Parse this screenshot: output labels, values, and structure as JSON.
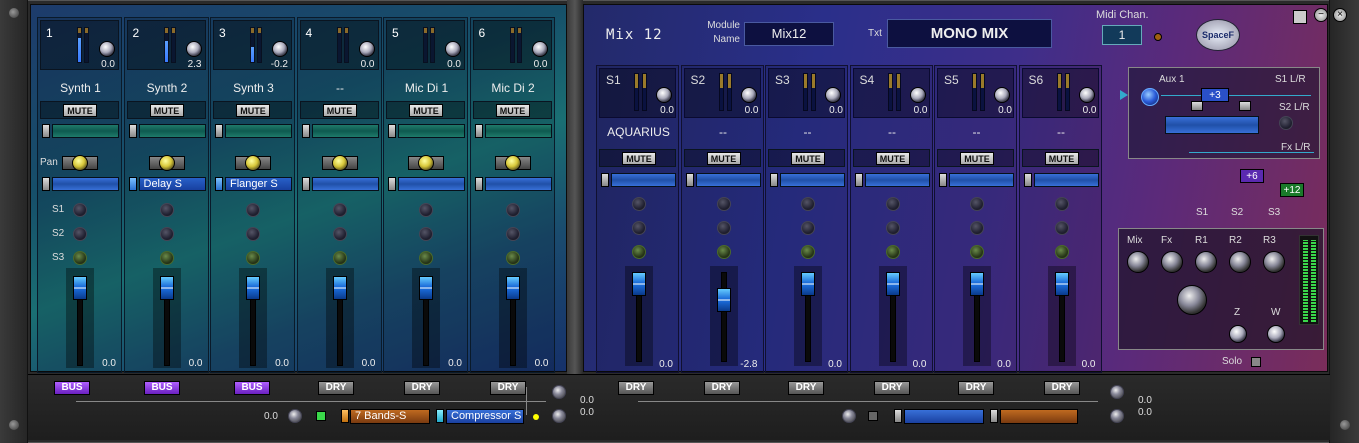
{
  "left_channels": [
    {
      "num": "1",
      "name": "Synth 1",
      "knob_val": "0.0",
      "fader_val": "0.0",
      "meter": 0.72,
      "insert": ""
    },
    {
      "num": "2",
      "name": "Synth 2",
      "knob_val": "2.3",
      "fader_val": "0.0",
      "meter": 0.62,
      "insert": "Delay S"
    },
    {
      "num": "3",
      "name": "Synth 3",
      "knob_val": "-0.2",
      "fader_val": "0.0",
      "meter": 0.45,
      "insert": "Flanger S"
    },
    {
      "num": "4",
      "name": "--",
      "knob_val": "0.0",
      "fader_val": "0.0",
      "meter": 0.0,
      "insert": ""
    },
    {
      "num": "5",
      "name": "Mic Di 1",
      "knob_val": "0.0",
      "fader_val": "0.0",
      "meter": 0.0,
      "insert": ""
    },
    {
      "num": "6",
      "name": "Mic Di 2",
      "knob_val": "0.0",
      "fader_val": "0.0",
      "meter": 0.0,
      "insert": ""
    }
  ],
  "labels": {
    "mute": "MUTE",
    "pan": "Pan",
    "s1": "S1",
    "s2": "S2",
    "s3": "S3",
    "bus": "BUS",
    "dry": "DRY",
    "solo": "Solo"
  },
  "header": {
    "mix_title": "Mix 12",
    "module_name_label_1": "Module",
    "module_name_label_2": "Name",
    "module_name": "Mix12",
    "txt_label": "Txt",
    "txt_value": "MONO MIX",
    "midi_label": "Midi Chan.",
    "midi_value": "1",
    "logo": "SpaceF"
  },
  "right_channels": [
    {
      "name": "S1",
      "label": "AQUARIUS",
      "knob_val": "0.0",
      "fader_val": "0.0"
    },
    {
      "name": "S2",
      "label": "--",
      "knob_val": "0.0",
      "fader_val": "-2.8"
    },
    {
      "name": "S3",
      "label": "--",
      "knob_val": "0.0",
      "fader_val": "0.0"
    },
    {
      "name": "S4",
      "label": "--",
      "knob_val": "0.0",
      "fader_val": "0.0"
    },
    {
      "name": "S5",
      "label": "--",
      "knob_val": "0.0",
      "fader_val": "0.0"
    },
    {
      "name": "S6",
      "label": "--",
      "knob_val": "0.0",
      "fader_val": "0.0"
    }
  ],
  "fx": {
    "aux": "Aux 1",
    "s1lr": "S1 L/R",
    "s2lr": "S2 L/R",
    "fxlr": "Fx L/R",
    "plus3": "+3",
    "plus6": "+6",
    "plus12": "+12",
    "s1": "S1",
    "s2": "S2",
    "s3": "S3",
    "knobs": [
      "Mix",
      "Fx",
      "R1",
      "R2",
      "R3"
    ],
    "z": "Z",
    "w": "W"
  },
  "bottom": {
    "left_val": "0.0",
    "slot1": "7 Bands-S",
    "slot2": "Compressor S",
    "out_val_1": "0.0",
    "out_val_2": "0.0",
    "right_out_1": "0.0",
    "right_out_2": "0.0"
  },
  "colors": {
    "accent_blue": "#2a70d8",
    "bus_purple": "#8a3ae8",
    "meter_green": "#3ad84a"
  }
}
